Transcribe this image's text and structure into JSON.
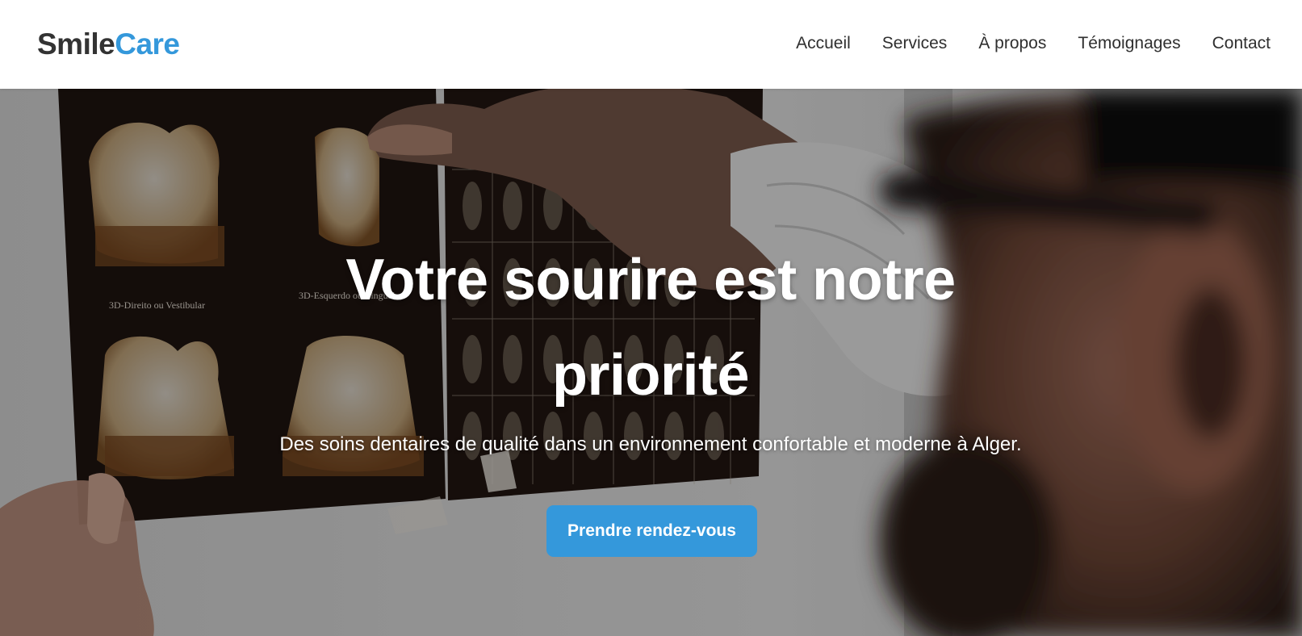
{
  "brand": {
    "name_primary": "Smile",
    "name_accent": "Care",
    "accent_color": "#3498db",
    "primary_color": "#333333"
  },
  "nav": {
    "items": [
      {
        "label": "Accueil"
      },
      {
        "label": "Services"
      },
      {
        "label": "À propos"
      },
      {
        "label": "Témoignages"
      },
      {
        "label": "Contact"
      }
    ]
  },
  "hero": {
    "title": "Votre sourire est notre priorité",
    "subtitle": "Des soins dentaires de qualité dans un environnement confortable et moderne à Alger.",
    "cta_label": "Prendre rendez-vous",
    "cta_color": "#3498db",
    "background": "dentist-xray-photo"
  }
}
